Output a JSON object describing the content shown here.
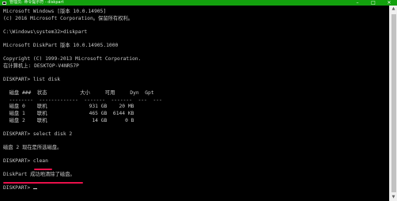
{
  "window": {
    "title": "管理员: 命令提示符 - diskpart",
    "controls": {
      "minimize": "–",
      "maximize": "□",
      "close": "✕"
    }
  },
  "console_lines": [
    "Microsoft Windows [版本 10.0.14905]",
    "(c) 2016 Microsoft Corporation。保留所有权利。",
    "",
    "C:\\Windows\\system32>diskpart",
    "",
    "Microsoft DiskPart 版本 10.0.14905.1000",
    "",
    "Copyright (C) 1999-2013 Microsoft Corporation.",
    "在计算机上: DESKTOP-V4NR57P",
    "",
    "DISKPART> list disk",
    "",
    "  磁盘 ###  状态           大小     可用     Dyn  Gpt",
    "  --------  -------------  -------  -------  ---  ---",
    "  磁盘 0    联机              931 GB    20 MB",
    "  磁盘 1    联机              465 GB  6144 KB",
    "  磁盘 2    联机               14 GB      0 B",
    "",
    "DISKPART> select disk 2",
    "",
    "磁盘 2 现在是所选磁盘。",
    "",
    "DISKPART> clean",
    "",
    "DiskPart 成功地清除了磁盘。",
    "",
    "DISKPART> "
  ],
  "colors": {
    "titlebar": "#13a10e",
    "console_bg": "#000000",
    "console_text": "#c9c9c9",
    "annotation": "#e8104a"
  }
}
